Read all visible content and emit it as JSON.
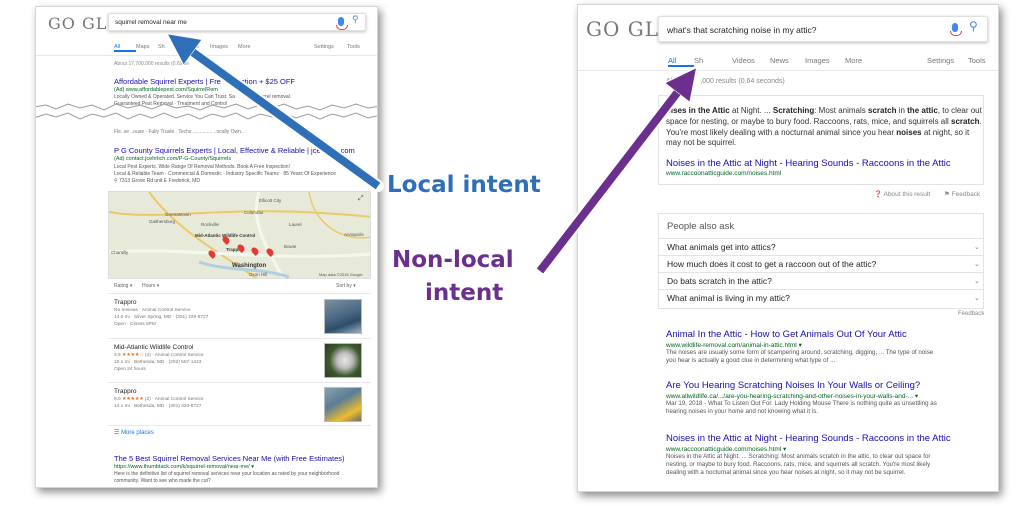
{
  "left": {
    "logo": "GO GLE",
    "query": "squirrel removal near me",
    "tabs": [
      "All",
      "Maps",
      "Sh",
      "Videos",
      "Images",
      "More"
    ],
    "tools": [
      "Settings",
      "Tools"
    ],
    "result_stats": "About 17,700,000 results (0.69 se",
    "ad1": {
      "title": "Affordable Squirrel Experts | Fre",
      "title_tail": "ection + $25 OFF",
      "url": "(Ad) www.affordablepest.com/SquirrelRem",
      "snippet1": "Locally Owned & Operated. Service You Can Trust. Sa",
      "snippet1_tail": "al squirrel removal.",
      "snippet2": "Guaranteed Pest Removal · Treatment and Control"
    },
    "torn_text": "Fle..se   ..ouse · Fully Truste.. Techs   ..............   ..ocally Own..",
    "ad2": {
      "title": "P G County Squirrels Experts | Local, Effective & Reliable | jce",
      "title_tail": "com",
      "url": "(Ad) contact.jcehrlich.com/P-G-County/Squirrels",
      "snippet1": "Local Pest Experts. Wide Range Of Removal Methods. Book A Free Inspection!",
      "snippet2": "Local & Reliable Team · Commercial & Domestic · Industry Specific Teams · 85 Years Of Experience",
      "address": "7313 Grove Rd unit E Frederick, MD"
    },
    "map": {
      "labels": [
        "Ellicott City",
        "Columbia",
        "Laurel",
        "Germantown",
        "Gaithersburg",
        "Rockville",
        "Mid-Atlantic Wildlife Control",
        "Trappro",
        "Bowie",
        "Washington",
        "Oxon Hill",
        "Chantilly",
        "Annapolis"
      ],
      "credit": "Map data ©2018 Google"
    },
    "filters": {
      "rating": "Rating",
      "hours": "Hours",
      "sort": "Sort by"
    },
    "listings": [
      {
        "name": "Trappro",
        "line1": "No reviews · Animal Control Service",
        "line2": "14.0 mi · Silver Spring, MD · (301) 229-8727",
        "line3": "Open · Closes 5PM"
      },
      {
        "name": "Mid-Atlantic Wildlife Control",
        "rating": "3.5",
        "stars": "★★★★☆",
        "line1": "(4) · Animal Control Service",
        "line2": "10.1 mi · Bethesda, MD · (202) 557-1443",
        "line3": "Open 24 hours"
      },
      {
        "name": "Trappro",
        "rating": "5.0",
        "stars": "★★★★★",
        "line1": "(2) · Animal Control Service",
        "line2": "14.1 mi · Bethesda, MD · (301) 323-8727",
        "line3": ""
      }
    ],
    "more_places": "More places",
    "organic": {
      "title": "The 5 Best Squirrel Removal Services Near Me (with Free Estimates)",
      "url": "https://www.thumbtack.com/k/squirrel-removal/near-me/",
      "snippet1": "Here is the definitive list of squirrel removal services near your location as rated by your neighborhood",
      "snippet2": "community. Want to see who made the cut?"
    }
  },
  "right": {
    "logo": "GO GLE",
    "query": "what's that scratching noise in my attic?",
    "tabs": [
      "All",
      "Sh",
      "Videos",
      "News",
      "Images",
      "More"
    ],
    "tools": [
      "Settings",
      "Tools"
    ],
    "result_stats": "About ",
    "result_stats_tail": ",000 results (0.64 seconds)",
    "featured": {
      "snippet_parts": [
        "oises in the Attic",
        " at Night. ... ",
        "Scratching",
        ": Most animals ",
        "scratch",
        " in ",
        "the attic",
        ", to clear out space for nesting, or maybe to bury food. Raccoons, rats, mice, and squirrels all ",
        "scratch",
        ". You're most likely dealing with a nocturnal animal since you hear ",
        "noises",
        " at night, so it may not be squirrel."
      ],
      "title": "Noises in the Attic at Night - Hearing Sounds - Raccoons in the Attic",
      "url": "www.raccoonatticguide.com/noises.html",
      "about": "About this result",
      "feedback": "Feedback"
    },
    "paa": {
      "title": "People also ask",
      "questions": [
        "What animals get into attics?",
        "How much does it cost to get a raccoon out of the attic?",
        "Do bats scratch in the attic?",
        "What animal is living in my attic?"
      ],
      "feedback": "Feedback"
    },
    "results": [
      {
        "title": "Animal In the Attic - How to Get Animals Out Of Your Attic",
        "url": "www.wildlife-removal.com/animal-in-attic.html",
        "snippet1": "The noises are usually some form of scampering around, scratching, digging, ... The type of noise",
        "snippet2": "you hear is actually a good clue in determining what type of ..."
      },
      {
        "title": "Are You Hearing Scratching Noises In Your Walls or Ceiling?",
        "url": "www.allwildlife.ca/.../are-you-hearing-scratching-and-other-noises-in-your-walls-and-...",
        "snippet1": "Mar 19, 2018 - What To Listen Out For. Lady Holding Mouse There is nothing quite as unsettling as",
        "snippet2": "hearing noises in your home and not knowing what it is."
      },
      {
        "title": "Noises in the Attic at Night - Hearing Sounds - Raccoons in the Attic",
        "url": "www.raccoonatticguide.com/noises.html",
        "snippet1": "Noises in the Attic at Night. ... Scratching: Most animals scratch in the attic, to clear out space for",
        "snippet2": "nesting, or maybe to bury food. Raccoons, rats, mice, and squirrels all scratch. You're most likely",
        "snippet3": "dealing with a nocturnal animal since you hear noises at night, so it may not be squirrel."
      }
    ]
  },
  "callouts": {
    "local": "Local intent",
    "nonlocal_line1": "Non-local",
    "nonlocal_line2": "intent"
  },
  "colors": {
    "local_arrow": "#2e6fb7",
    "nonlocal_arrow": "#6b2f8d",
    "link": "#1a0dab",
    "url": "#006621"
  }
}
